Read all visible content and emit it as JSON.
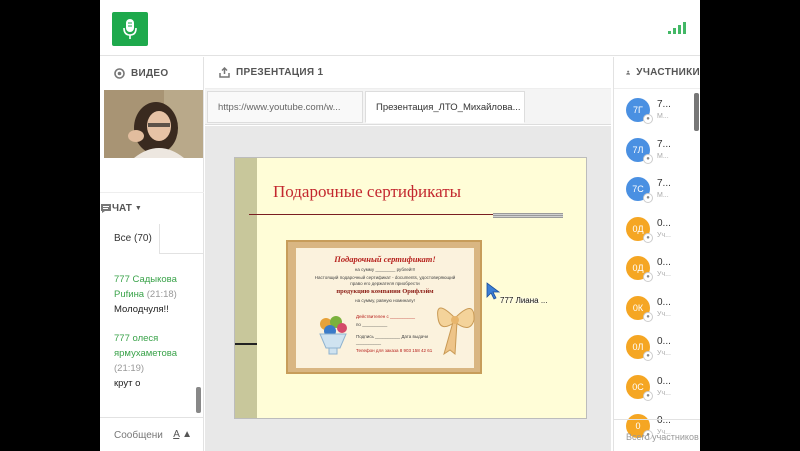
{
  "colors": {
    "accent": "#1ea94c",
    "chat_name": "#3aa34a",
    "slide_title": "#c3272e",
    "avatar_blue": "#4a90e2",
    "avatar_orange": "#f5a623"
  },
  "topbar": {
    "mic_icon": "microphone-icon",
    "signal_icon": "signal-strength-icon"
  },
  "video": {
    "title": "ВИДЕО"
  },
  "presentation": {
    "title": "ПРЕЗЕНТАЦИЯ 1",
    "tabs": [
      {
        "label": "https://www.youtube.com/w..."
      },
      {
        "label": "Презентация_ЛТО_Михайлова..."
      }
    ],
    "slide": {
      "title": "Подарочные сертификаты",
      "certificate": {
        "heading": "Подарочный сертификат!",
        "line1": "на сумму ________ рублей!!!",
        "line2": "Настоящий подарочный сертификат - documents, удостоверяющий",
        "line3": "право его держателя приобрести",
        "red": "продукцию компании Орифлэйм",
        "line4": "на сумму, равную номиналу!",
        "line5": "Действителен с __________",
        "line6": "по __________",
        "line7": "Подпись __________ Дата выдачи __________",
        "line8": "Телефон для заказа 8 903 158 42 61"
      }
    },
    "pointer_label": "777 Лиана ..."
  },
  "chat": {
    "title": "ЧАТ",
    "tab_all": "Все (70)",
    "messages": [
      {
        "author": "777 Садыкова Рufина",
        "time": "(21:18)",
        "text": "Молодчуля!!"
      },
      {
        "author": "777 олеся ярмухаметова",
        "time": "(21:19)",
        "text": "крут о"
      }
    ],
    "input_placeholder": "Сообщени",
    "format_icon": "A"
  },
  "participants": {
    "title": "УЧАСТНИКИ",
    "footer": "Всего участников",
    "items": [
      {
        "initials": "7Г",
        "name": "7...",
        "role": "М...",
        "color": "#4a90e2"
      },
      {
        "initials": "7Л",
        "name": "7...",
        "role": "М...",
        "color": "#4a90e2"
      },
      {
        "initials": "7С",
        "name": "7...",
        "role": "М...",
        "color": "#4a90e2"
      },
      {
        "initials": "0Д",
        "name": "0...",
        "role": "Уч...",
        "color": "#f5a623"
      },
      {
        "initials": "0Д",
        "name": "0...",
        "role": "Уч...",
        "color": "#f5a623"
      },
      {
        "initials": "0К",
        "name": "0...",
        "role": "Уч...",
        "color": "#f5a623"
      },
      {
        "initials": "0Л",
        "name": "0...",
        "role": "Уч...",
        "color": "#f5a623"
      },
      {
        "initials": "0С",
        "name": "0...",
        "role": "Уч...",
        "color": "#f5a623"
      },
      {
        "initials": "0",
        "name": "0...",
        "role": "Уч...",
        "color": "#f5a623"
      }
    ]
  }
}
